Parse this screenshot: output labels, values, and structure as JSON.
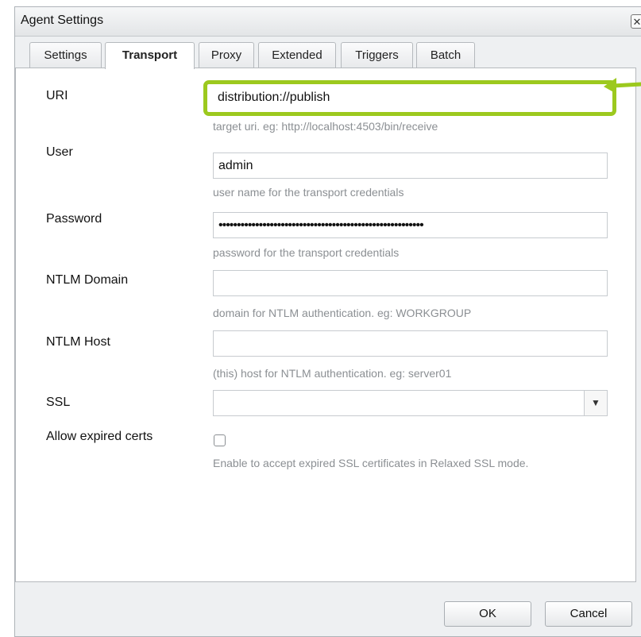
{
  "dialog": {
    "title": "Agent Settings",
    "close_label": "✕"
  },
  "tabs": [
    {
      "label": "Settings"
    },
    {
      "label": "Transport"
    },
    {
      "label": "Proxy"
    },
    {
      "label": "Extended"
    },
    {
      "label": "Triggers"
    },
    {
      "label": "Batch"
    }
  ],
  "active_tab": "Transport",
  "fields": {
    "uri": {
      "label": "URI",
      "value": "distribution://publish",
      "hint": "target uri. eg: http://localhost:4503/bin/receive"
    },
    "user": {
      "label": "User",
      "value": "admin",
      "hint": "user name for the transport credentials"
    },
    "password": {
      "label": "Password",
      "value": "••••••••••••••••••••••••••••••••••••••••••••••••••••••••",
      "hint": "password for the transport credentials"
    },
    "ntlm_domain": {
      "label": "NTLM Domain",
      "value": "",
      "hint": "domain for NTLM authentication. eg: WORKGROUP"
    },
    "ntlm_host": {
      "label": "NTLM Host",
      "value": "",
      "hint": "(this) host for NTLM authentication. eg: server01"
    },
    "ssl": {
      "label": "SSL",
      "value": "",
      "arrow": "▼"
    },
    "allow_expired": {
      "label": "Allow expired certs",
      "checked": false,
      "hint": "Enable to accept expired SSL certificates in Relaxed SSL mode."
    }
  },
  "buttons": {
    "ok": "OK",
    "cancel": "Cancel"
  },
  "colors": {
    "highlight": "#9cc91e",
    "arrow": "#9cc91e"
  },
  "icons": {
    "close": "close-icon",
    "dropdown": "chevron-down-icon",
    "callout": "arrow-left-icon"
  }
}
